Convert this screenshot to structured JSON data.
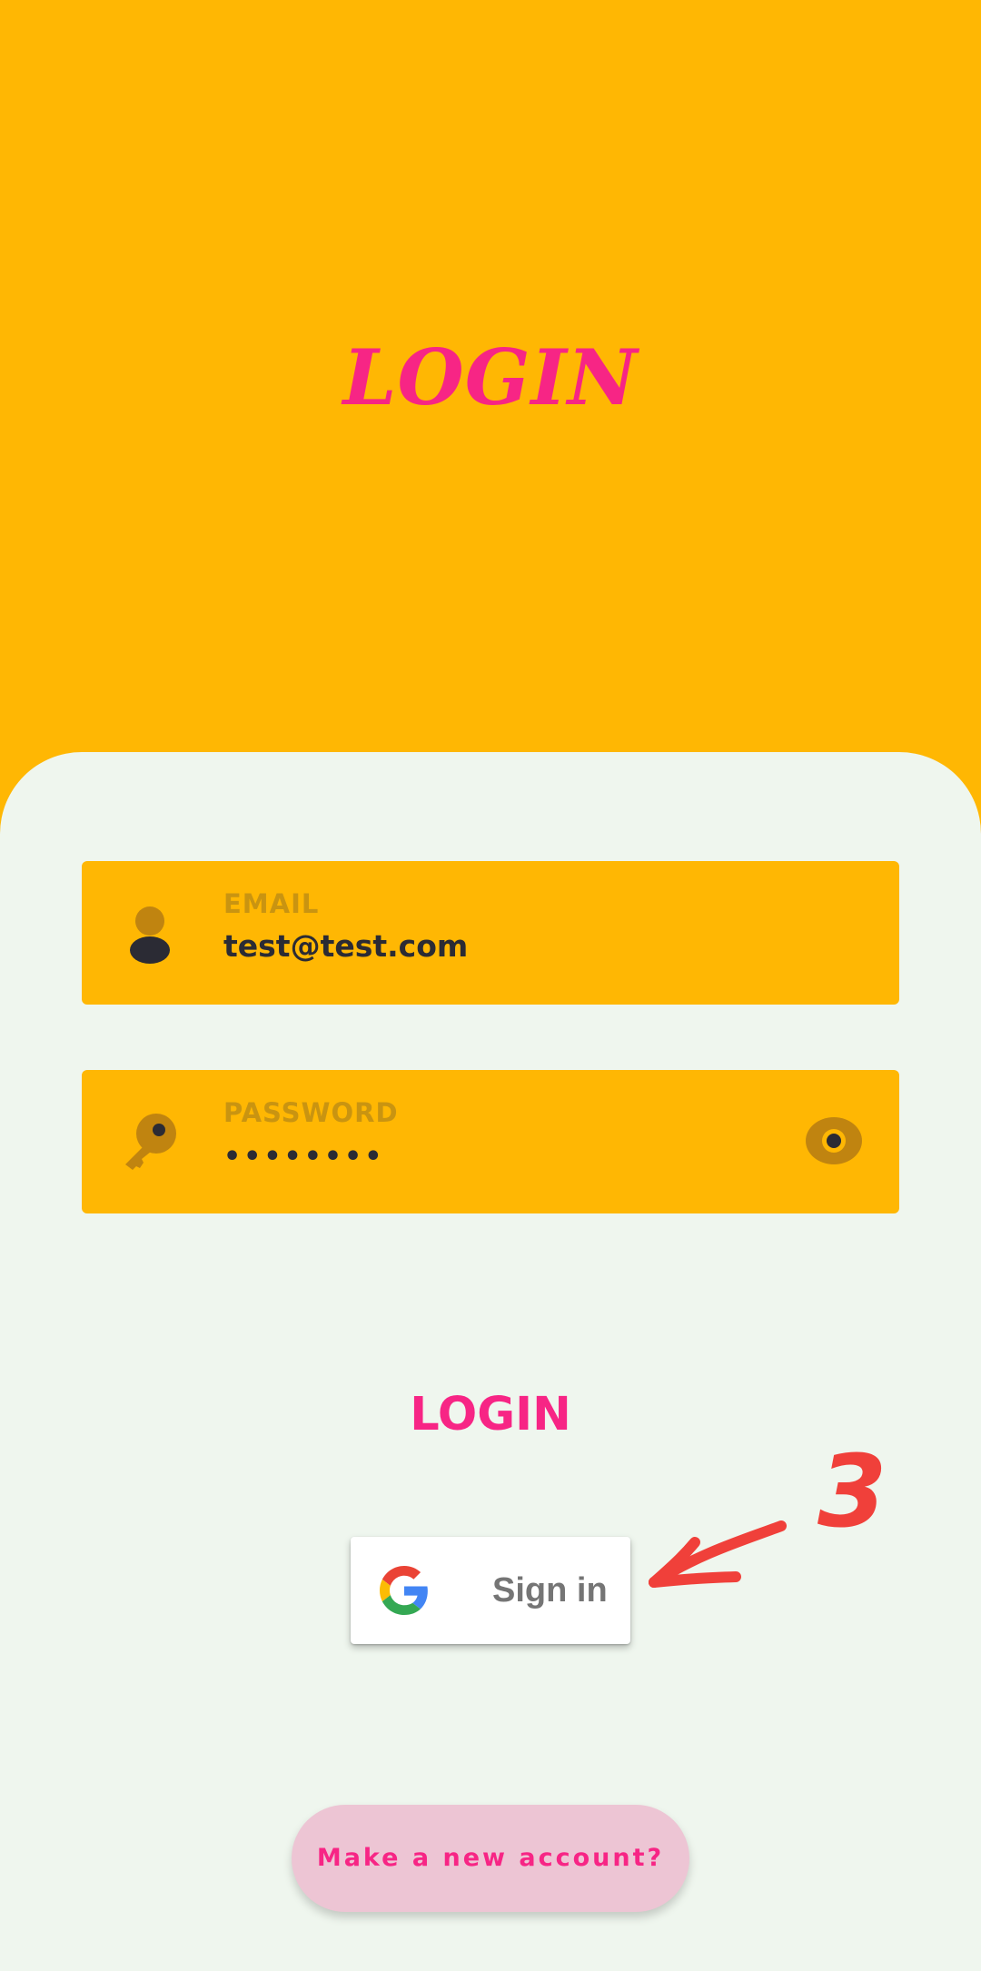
{
  "colors": {
    "header_bg": "#FFB703",
    "card_bg": "#EFF6EE",
    "accent_pink": "#F72585",
    "field_bg": "#FFB703",
    "field_icon": "#C08410",
    "field_text": "#2B2B34",
    "new_account_bg": "#EDC5D4",
    "annotation_red": "#F0403A"
  },
  "header": {
    "title": "LOGIN"
  },
  "form": {
    "email": {
      "label": "EMAIL",
      "value": "test@test.com",
      "icon": "person-icon"
    },
    "password": {
      "label": "PASSWORD",
      "value": "••••••••",
      "icon": "key-icon",
      "toggle_icon": "eye-icon"
    },
    "login_label": "LOGIN"
  },
  "google": {
    "label": "Sign in",
    "icon": "google-logo-icon"
  },
  "annotation": {
    "text": "3",
    "icon": "arrow-left-icon"
  },
  "footer": {
    "new_account_label": "Make a new account?"
  }
}
